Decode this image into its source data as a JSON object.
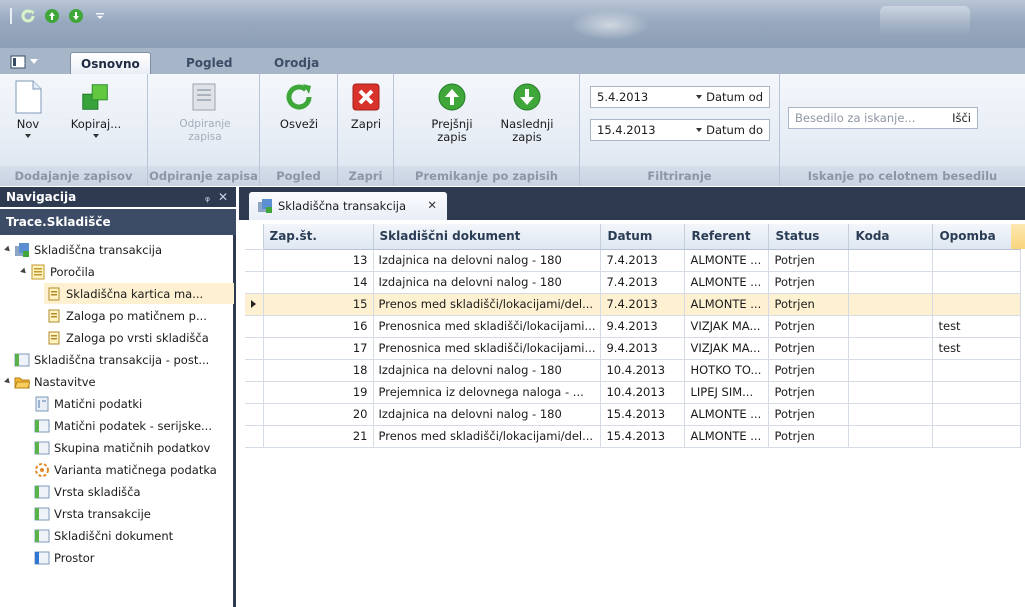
{
  "window": {
    "title": ""
  },
  "tabs": [
    {
      "label": "Osnovno",
      "active": true
    },
    {
      "label": "Pogled",
      "active": false
    },
    {
      "label": "Orodja",
      "active": false
    }
  ],
  "ribbon": {
    "groups": [
      {
        "caption": "Dodajanje zapisov",
        "buttons": [
          {
            "label": "Nov"
          },
          {
            "label": "Kopiraj..."
          }
        ]
      },
      {
        "caption": "Odpiranje zapisa",
        "buttons": [
          {
            "label": "Odpiranje zapisa",
            "disabled": true
          }
        ]
      },
      {
        "caption": "Pogled",
        "buttons": [
          {
            "label": "Osveži"
          }
        ]
      },
      {
        "caption": "Zapri",
        "buttons": [
          {
            "label": "Zapri"
          }
        ]
      },
      {
        "caption": "Premikanje po zapisih",
        "buttons": [
          {
            "label": "Prejšnji zapis"
          },
          {
            "label": "Naslednji zapis"
          }
        ]
      },
      {
        "caption": "Filtriranje"
      },
      {
        "caption": "Iskanje po celotnem besedilu"
      }
    ],
    "filter": {
      "date_from_value": "5.4.2013",
      "date_from_label": "Datum od",
      "date_to_value": "15.4.2013",
      "date_to_label": "Datum do"
    },
    "search": {
      "placeholder": "Besedilo za iskanje...",
      "button": "Išči"
    }
  },
  "navigation": {
    "header": "Navigacija",
    "root": "Trace.Skladišče",
    "items": [
      {
        "label": "Skladiščna transakcija",
        "level": 0,
        "expanded": true
      },
      {
        "label": "Poročila",
        "level": 1,
        "expanded": true
      },
      {
        "label": "Skladiščna kartica ma...",
        "level": 2,
        "selected": true
      },
      {
        "label": "Zaloga po matičnem p...",
        "level": 2
      },
      {
        "label": "Zaloga po vrsti skladišča",
        "level": 2
      },
      {
        "label": "Skladiščna transakcija - post...",
        "level": 0
      },
      {
        "label": "Nastavitve",
        "level": 0,
        "expanded": true
      },
      {
        "label": "Matični podatki",
        "level": 1
      },
      {
        "label": "Matični podatek - serijske...",
        "level": 1
      },
      {
        "label": "Skupina matičnih podatkov",
        "level": 1
      },
      {
        "label": "Varianta matičnega podatka",
        "level": 1
      },
      {
        "label": "Vrsta skladišča",
        "level": 1
      },
      {
        "label": "Vrsta transakcije",
        "level": 1
      },
      {
        "label": "Skladiščni dokument",
        "level": 1
      },
      {
        "label": "Prostor",
        "level": 1
      }
    ]
  },
  "document_tab": {
    "label": "Skladiščna transakcija"
  },
  "grid": {
    "columns": [
      "Zap.št.",
      "Skladiščni dokument",
      "Datum",
      "Referent",
      "Status",
      "Koda",
      "Opomba"
    ],
    "rows": [
      {
        "zap": "13",
        "dokument": "Izdajnica na delovni nalog - 180",
        "datum": "7.4.2013",
        "referent": "ALMONTE ...",
        "status": "Potrjen",
        "koda": "",
        "opomba": ""
      },
      {
        "zap": "14",
        "dokument": "Izdajnica na delovni nalog - 180",
        "datum": "7.4.2013",
        "referent": "ALMONTE ...",
        "status": "Potrjen",
        "koda": "",
        "opomba": ""
      },
      {
        "zap": "15",
        "dokument": "Prenos med skladišči/lokacijami/del...",
        "datum": "7.4.2013",
        "referent": "ALMONTE ...",
        "status": "Potrjen",
        "koda": "",
        "opomba": "",
        "current": true
      },
      {
        "zap": "16",
        "dokument": "Prenosnica med skladišči/lokacijami...",
        "datum": "9.4.2013",
        "referent": "VIZJAK MA...",
        "status": "Potrjen",
        "koda": "",
        "opomba": "test"
      },
      {
        "zap": "17",
        "dokument": "Prenosnica med skladišči/lokacijami...",
        "datum": "9.4.2013",
        "referent": "VIZJAK MA...",
        "status": "Potrjen",
        "koda": "",
        "opomba": "test"
      },
      {
        "zap": "18",
        "dokument": "Izdajnica na delovni nalog - 180",
        "datum": "10.4.2013",
        "referent": "HOTKO TO...",
        "status": "Potrjen",
        "koda": "",
        "opomba": ""
      },
      {
        "zap": "19",
        "dokument": "Prejemnica iz delovnega naloga - ...",
        "datum": "10.4.2013",
        "referent": "LIPEJ SIM...",
        "status": "Potrjen",
        "koda": "",
        "opomba": ""
      },
      {
        "zap": "20",
        "dokument": "Izdajnica na delovni nalog - 180",
        "datum": "15.4.2013",
        "referent": "ALMONTE ...",
        "status": "Potrjen",
        "koda": "",
        "opomba": ""
      },
      {
        "zap": "21",
        "dokument": "Prenos med skladišči/lokacijami/del...",
        "datum": "15.4.2013",
        "referent": "ALMONTE ...",
        "status": "Potrjen",
        "koda": "",
        "opomba": ""
      }
    ]
  },
  "colors": {
    "nav_dark": "#2d3a4f",
    "selection": "#fdf1d2",
    "accent_green": "#3fa63a",
    "close_red": "#d8322b"
  }
}
